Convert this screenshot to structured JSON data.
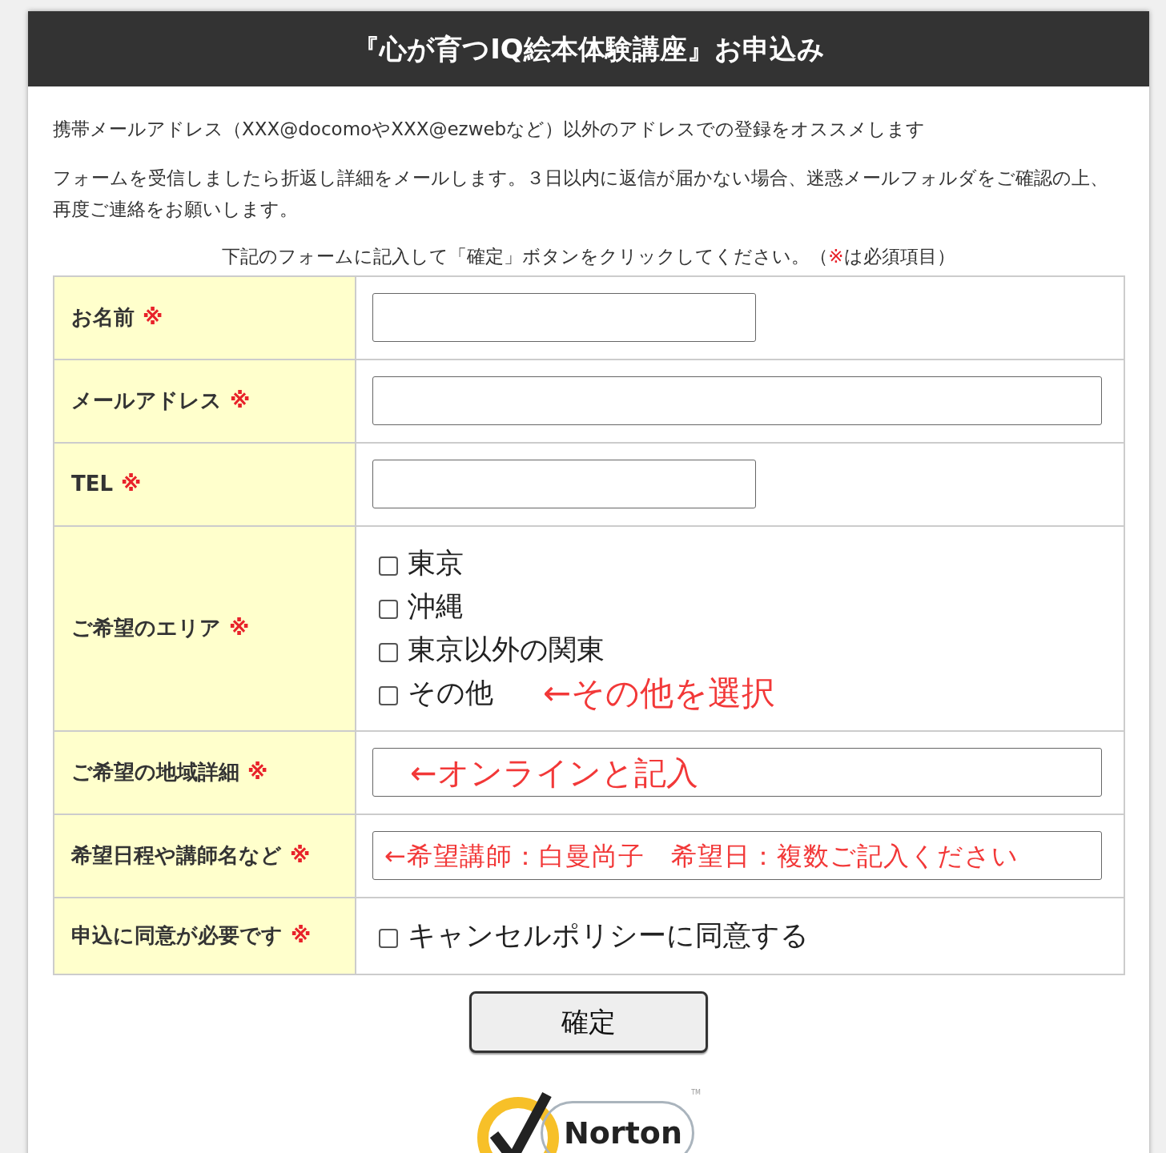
{
  "header": {
    "title": "『心が育つIQ絵本体験講座』お申込み"
  },
  "notes": [
    "携帯メールアドレス（XXX@docomoやXXX@ezwebなど）以外のアドレスでの登録をオススメします",
    "フォームを受信しましたら折返し詳細をメールします。３日以内に返信が届かない場合、迷惑メールフォルダをご確認の上、再度ご連絡をお願いします。"
  ],
  "instruction": {
    "before": "下記のフォームに記入して「確定」ボタンをクリックしてください。（",
    "mark": "※",
    "after": "は必須項目）"
  },
  "rows": [
    {
      "label": "お名前",
      "required": "※",
      "kind": "short_input"
    },
    {
      "label": "メールアドレス",
      "required": "※",
      "kind": "long_input"
    },
    {
      "label": "TEL",
      "required": "※",
      "kind": "short_input"
    },
    {
      "label": "ご希望のエリア",
      "required": "※",
      "kind": "checkboxes",
      "options": [
        {
          "label": "東京",
          "checked": false
        },
        {
          "label": "沖縄",
          "checked": false
        },
        {
          "label": "東京以外の関東",
          "checked": false
        },
        {
          "label": "その他",
          "checked": false,
          "note": "←その他を選択"
        }
      ]
    },
    {
      "label": "ご希望の地域詳細",
      "required": "※",
      "kind": "long_input",
      "note": "←オンラインと記入"
    },
    {
      "label": "希望日程や講師名など",
      "required": "※",
      "kind": "long_input",
      "note": "←希望講師：白曼尚子　希望日：複数ご記入ください"
    },
    {
      "label": "申込に同意が必要です",
      "required": "※",
      "kind": "checkbox",
      "option": {
        "label": "キャンセルポリシーに同意する",
        "checked": false
      }
    }
  ],
  "submit": "確定",
  "badge": {
    "name": "Norton",
    "tm": "TM"
  }
}
